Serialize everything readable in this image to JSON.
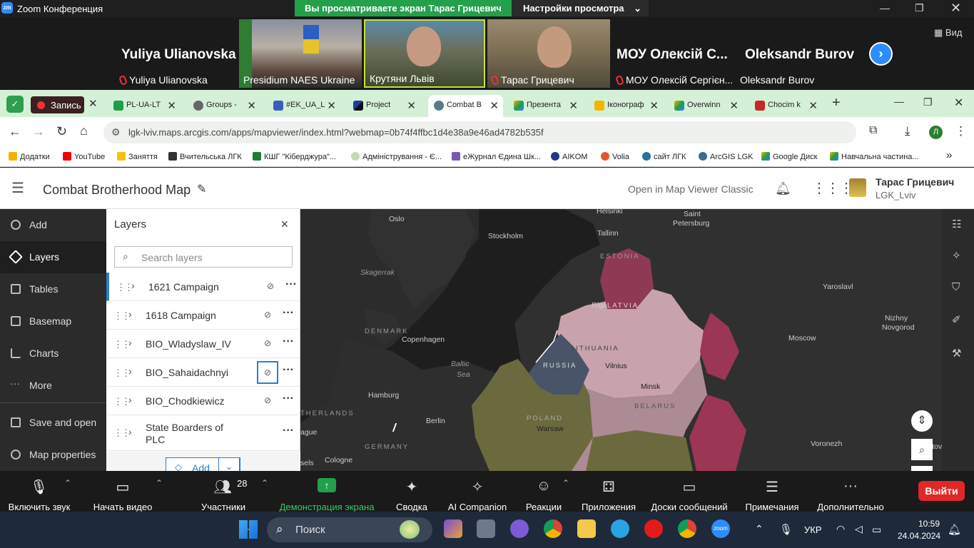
{
  "zoom": {
    "title": "Zoom Конференция",
    "share_banner": "Вы просматриваете экран Тарас Грицевич",
    "view_settings": "Настройки просмотра",
    "view_btn": "Вид"
  },
  "participants": [
    {
      "big": "Yuliya Ulianovska",
      "name": "Yuliya Ulianovska",
      "muted": true
    },
    {
      "big": "",
      "name": "Presidium NAES Ukraine",
      "muted": false
    },
    {
      "big": "",
      "name": "Крутяни Львів",
      "muted": false
    },
    {
      "big": "",
      "name": "Тарас Грицевич",
      "muted": true
    },
    {
      "big": "МОУ Олексій С...",
      "name": "МОУ Олексій Сергієн...",
      "muted": true
    },
    {
      "big": "Oleksandr Burov",
      "name": "Oleksandr Burov",
      "muted": false
    }
  ],
  "browser": {
    "record": "Запись",
    "tabs": [
      "PL-UA-LT",
      "Groups - ",
      "#EK_UA_L",
      "Project",
      "Combat B",
      "Презента",
      "Іконограф",
      "Overwinn",
      "Chocim k"
    ],
    "url": "lgk-lviv.maps.arcgis.com/apps/mapviewer/index.html?webmap=0b74f4ffbc1d4e38a9e46ad4782b535f",
    "profile": "Л",
    "bookmarks": [
      "Додатки",
      "YouTube",
      "Заняття",
      "Вчительська ЛГК",
      "КШГ \"Кіберджура\"...",
      "Адміністрування - Є...",
      "еЖурнал Єдина Шк...",
      "AIKOM",
      "Volia",
      "сайт ЛГК",
      "ArcGIS LGK",
      "Google Диск",
      "Навчальна частина..."
    ]
  },
  "arcgis": {
    "map_title": "Combat Brotherhood Map",
    "classic_link": "Open in Map Viewer Classic",
    "user_name": "Тарас Грицевич",
    "user_org": "LGK_Lviv",
    "nav": [
      "Add",
      "Layers",
      "Tables",
      "Basemap",
      "Charts",
      "More",
      "Save and open",
      "Map properties"
    ],
    "panel_title": "Layers",
    "search_placeholder": "Search layers",
    "layers": [
      "1621 Campaign",
      "1618 Campaign",
      "BIO_Wladyslaw_IV",
      "BIO_Sahaidachnyi",
      "BIO_Chodkiewicz",
      "State Boarders of PLC"
    ],
    "add_btn": "Add"
  },
  "map_labels": {
    "oslo": "Oslo",
    "helsinki": "Helsinki",
    "saint": "Saint",
    "petersburg": "Petersburg",
    "stockholm": "Stockholm",
    "tallinn": "Tallinn",
    "estonia": "ESTONIA",
    "skagerrak": "Skagerrak",
    "riga": "Riga",
    "latvia": "LATVIA",
    "yaroslavl": "Yaroslavl",
    "denmark": "DENMARK",
    "copenhagen": "Copenhagen",
    "lithuania": "LITHUANIA",
    "nizhny": "Nizhny",
    "novgorod": "Novgorod",
    "moscow": "Moscow",
    "baltic": "Baltic",
    "sea": "Sea",
    "russia": "RUSSIA",
    "vilnius": "Vilnius",
    "hamburg": "Hamburg",
    "minsk": "Minsk",
    "belarus": "BELARUS",
    "netherlands": "THERLANDS",
    "poland": "POLAND",
    "berlin": "Berlin",
    "warsaw": "Warsaw",
    "hague": "ague",
    "germany": "GERMANY",
    "voronezh": "Voronezh",
    "cologne": "Cologne",
    "sels": "sels",
    "stov": "stov"
  },
  "zoom_bar": {
    "mute": "Включить звук",
    "video": "Начать видео",
    "participants": "Участники",
    "participants_count": "28",
    "share": "Демонстрация экрана",
    "summary": "Сводка",
    "ai": "AI Companion",
    "reactions": "Реакции",
    "apps": "Приложения",
    "boards": "Доски сообщений",
    "notes": "Примечания",
    "more": "Дополнительно",
    "leave": "Выйти"
  },
  "taskbar": {
    "search": "Поиск",
    "lang": "УКР",
    "time": "10:59",
    "date": "24.04.2024"
  }
}
